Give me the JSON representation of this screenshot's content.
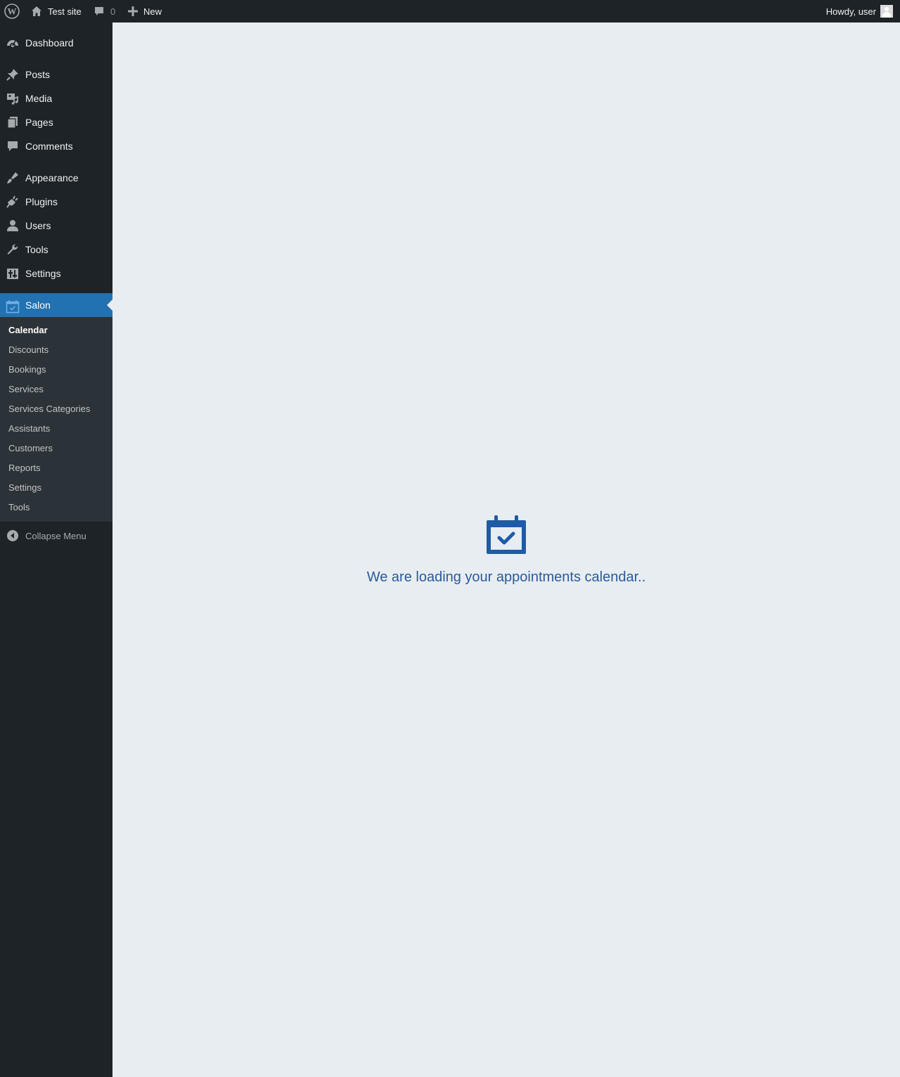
{
  "admin_bar": {
    "site_name": "Test site",
    "comments_count": "0",
    "new_label": "New",
    "account_greeting": "Howdy, user"
  },
  "sidebar": {
    "items": [
      {
        "label": "Dashboard",
        "icon": "dashboard-icon"
      },
      {
        "label": "Posts",
        "icon": "pushpin-icon"
      },
      {
        "label": "Media",
        "icon": "media-icon"
      },
      {
        "label": "Pages",
        "icon": "pages-icon"
      },
      {
        "label": "Comments",
        "icon": "comment-icon"
      },
      {
        "label": "Appearance",
        "icon": "brush-icon"
      },
      {
        "label": "Plugins",
        "icon": "plugin-icon"
      },
      {
        "label": "Users",
        "icon": "user-icon"
      },
      {
        "label": "Tools",
        "icon": "wrench-icon"
      },
      {
        "label": "Settings",
        "icon": "settings-icon"
      },
      {
        "label": "Salon",
        "icon": "calendar-check-icon"
      }
    ],
    "submenu": [
      "Calendar",
      "Discounts",
      "Bookings",
      "Services",
      "Services Categories",
      "Assistants",
      "Customers",
      "Reports",
      "Settings",
      "Tools"
    ],
    "collapse_label": "Collapse Menu"
  },
  "main": {
    "loading_message": "We are loading your appointments calendar.."
  },
  "colors": {
    "accent": "#2271b1",
    "loader_text": "#2a5a9a",
    "background": "#e8edf1"
  }
}
